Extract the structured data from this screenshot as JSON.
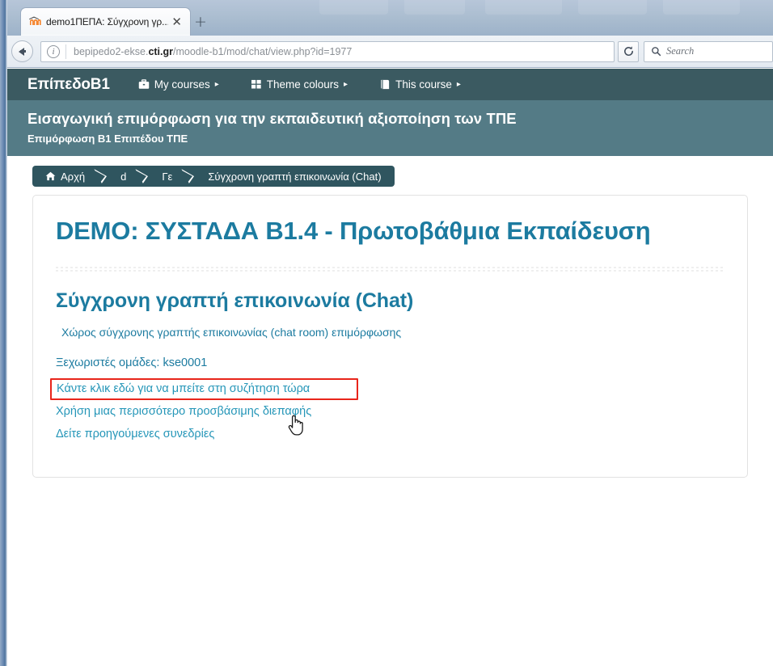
{
  "browser": {
    "tab": {
      "title": "demo1ΠΕΠΑ: Σύγχρονη γρ...",
      "favicon": "moodle-logo-icon",
      "close_label": "✕"
    },
    "new_tab_label": "+",
    "back_label": "Back",
    "url": {
      "prefix": "bepipedo2-ekse.",
      "domain": "cti.gr",
      "path": "/moodle-b1/mod/chat/view.php?id=1977",
      "full": "bepipedo2-ekse.cti.gr/moodle-b1/mod/chat/view.php?id=1977"
    },
    "reload_label": "Reload",
    "search": {
      "placeholder": "Search",
      "value": ""
    }
  },
  "navbar": {
    "brand": "ΕπίπεδοB1",
    "items": [
      {
        "label": "My courses",
        "icon": "briefcase-icon",
        "caret": "▸"
      },
      {
        "label": "Theme colours",
        "icon": "grid-squares-icon",
        "caret": "▸"
      },
      {
        "label": "This course",
        "icon": "book-icon",
        "caret": "▸"
      }
    ]
  },
  "course_header": {
    "title": "Εισαγωγική επιμόρφωση για την εκπαιδευτική αξιοποίηση των ΤΠΕ",
    "subtitle": "Επιμόρφωση Β1 Επιπέδου ΤΠΕ"
  },
  "breadcrumb": {
    "items": [
      {
        "label": "Αρχή",
        "icon": "home-icon"
      },
      {
        "label": "d",
        "icon": ""
      },
      {
        "label": "Γε",
        "icon": ""
      },
      {
        "label": "Σύγχρονη γραπτή επικοινωνία (Chat)",
        "icon": ""
      }
    ]
  },
  "main": {
    "page_title": "DEMO: ΣΥΣΤΑΔΑ Β1.4 - Πρωτοβάθμια Εκπαίδευση",
    "activity_title": "Σύγχρονη γραπτή επικοινωνία (Chat)",
    "intro": "Χώρος σύγχρονης γραπτής επικοινωνίας (chat room) επιμόρφωσης",
    "groups_line": "Ξεχωριστές ομάδες: kse0001",
    "links": [
      {
        "label": "Κάντε κλικ εδώ για να μπείτε στη συζήτηση τώρα",
        "highlighted": true
      },
      {
        "label": "Χρήση μιας περισσότερο προσβάσιμης διεπαφής",
        "highlighted": false
      },
      {
        "label": "Δείτε προηγούμενες συνεδρίες",
        "highlighted": false
      }
    ]
  },
  "colors": {
    "navbar_bg": "#3b5a61",
    "course_header_bg": "#547b86",
    "breadcrumb_bg": "#2f555f",
    "heading": "#1c7ba0",
    "link": "#2596b8",
    "highlight_border": "#e8251b"
  }
}
